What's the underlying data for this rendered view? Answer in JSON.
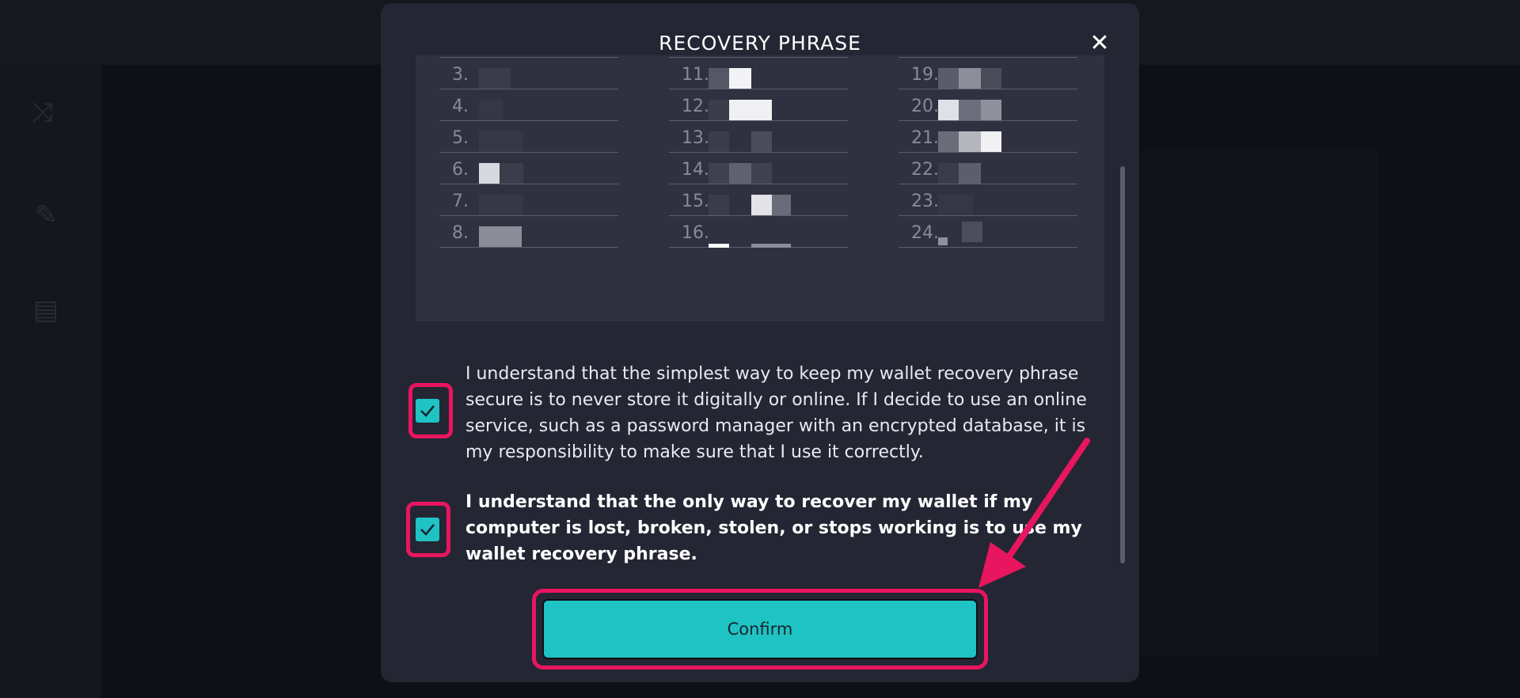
{
  "modal": {
    "title": "RECOVERY PHRASE",
    "close_symbol": "✕"
  },
  "phrase": {
    "columns": [
      [
        "3.",
        "4.",
        "5.",
        "6.",
        "7.",
        "8."
      ],
      [
        "11.",
        "12.",
        "13.",
        "14.",
        "15.",
        "16."
      ],
      [
        "19.",
        "20.",
        "21.",
        "22.",
        "23.",
        "24."
      ]
    ]
  },
  "agreements": [
    {
      "text": "I understand that the simplest way to keep my wallet recovery phrase secure is to never store it digitally or online. If I decide to use an online service, such as a password manager with an encrypted database, it is my responsibility to make sure that I use it correctly.",
      "checked": true
    },
    {
      "text": "I understand that the only way to recover my wallet if my computer is lost, broken, stolen, or stops working is to use my wallet recovery phrase.",
      "checked": true
    }
  ],
  "confirm_button": {
    "label": "Confirm"
  },
  "colors": {
    "accent": "#1fc3c3",
    "highlight": "#e8155f",
    "modal_bg": "#242633"
  },
  "icons": [
    "close-icon",
    "checkmark-icon",
    "annotation-arrow"
  ]
}
